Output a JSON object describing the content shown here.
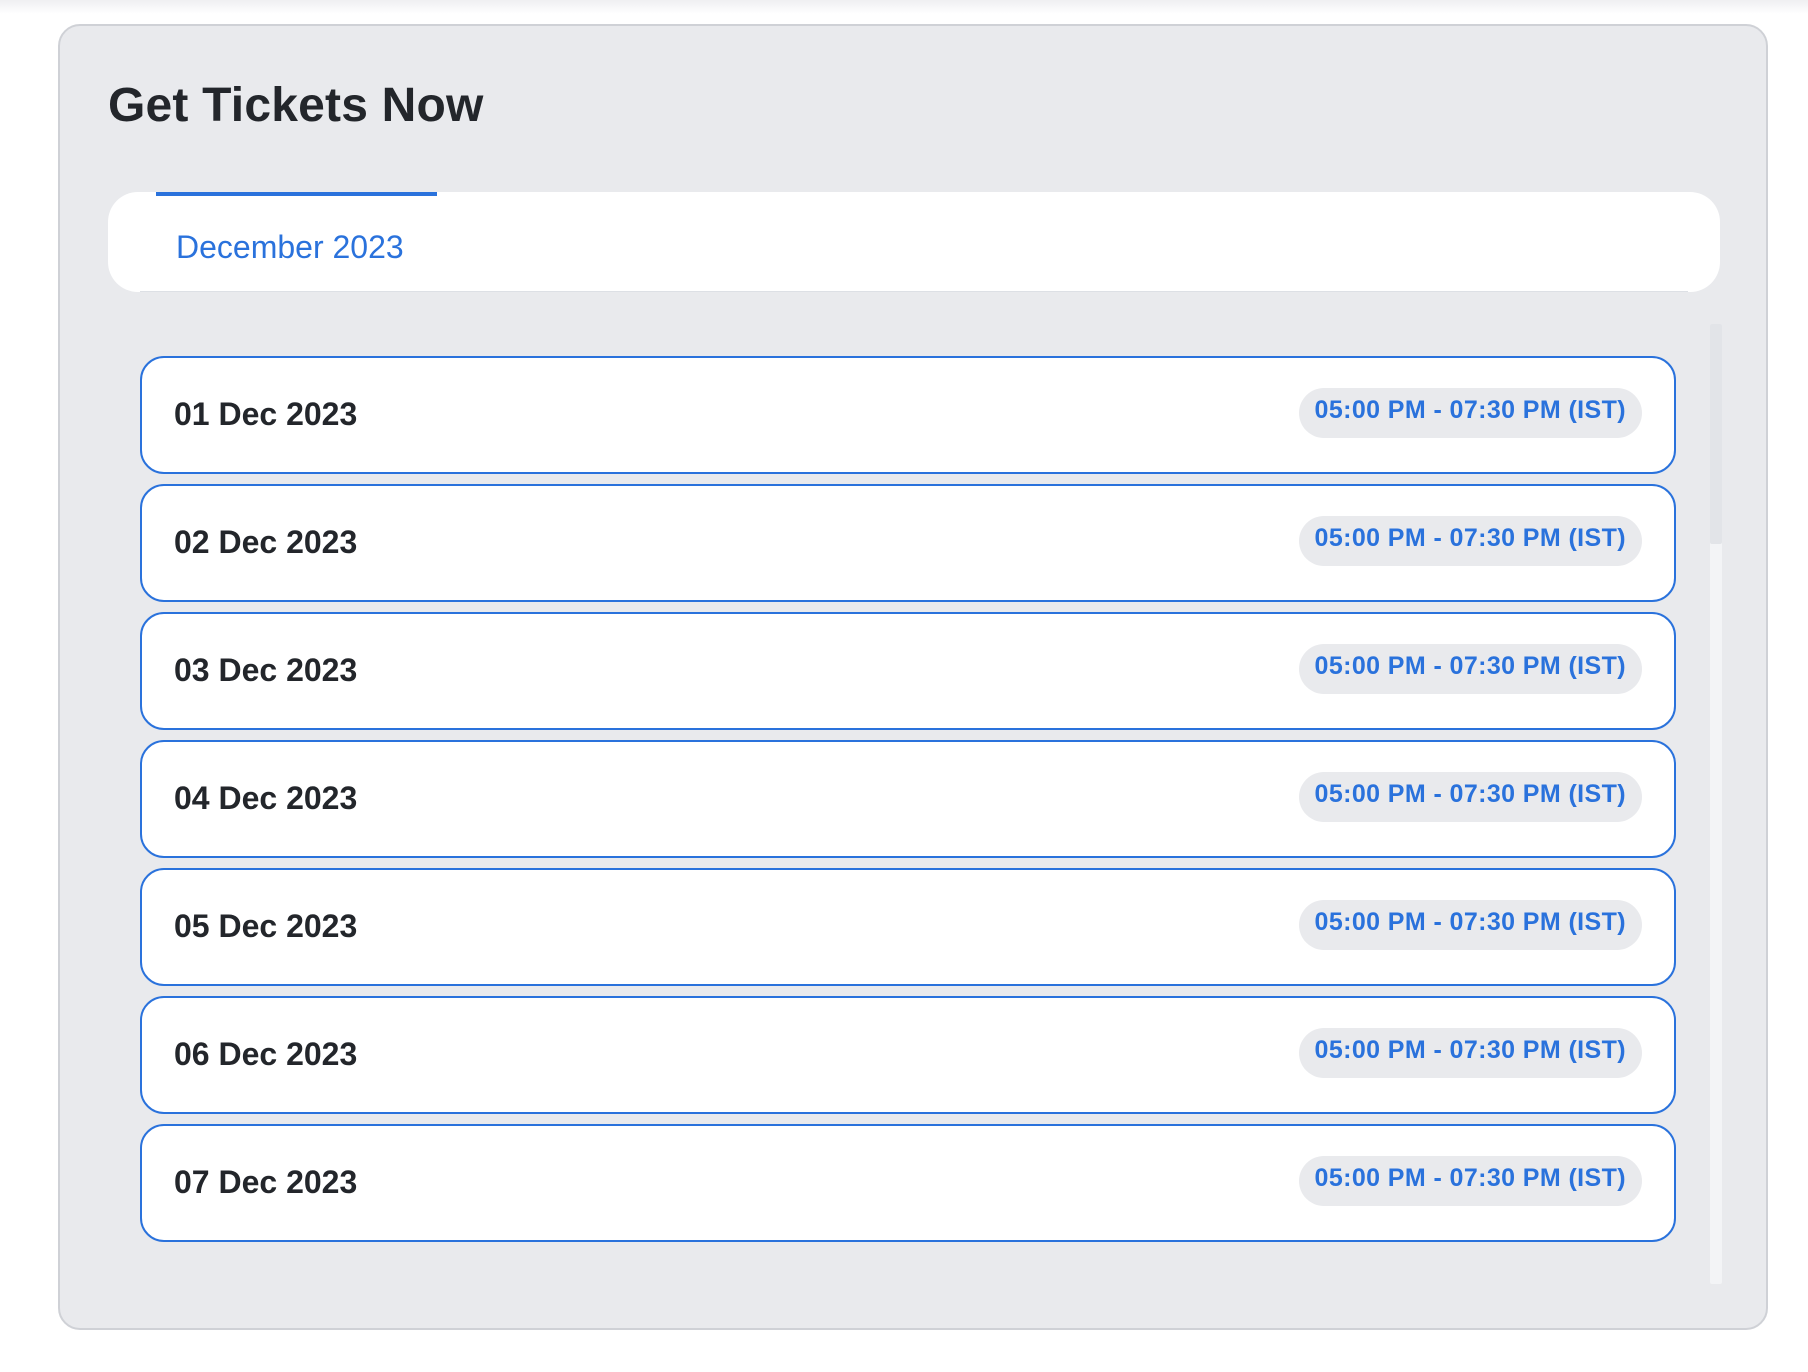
{
  "widget": {
    "title": "Get Tickets Now"
  },
  "tabs": [
    {
      "label": "December 2023",
      "active": true
    }
  ],
  "schedule": [
    {
      "date": "01 Dec 2023",
      "time": "05:00 PM - 07:30 PM (IST)"
    },
    {
      "date": "02 Dec 2023",
      "time": "05:00 PM - 07:30 PM (IST)"
    },
    {
      "date": "03 Dec 2023",
      "time": "05:00 PM - 07:30 PM (IST)"
    },
    {
      "date": "04 Dec 2023",
      "time": "05:00 PM - 07:30 PM (IST)"
    },
    {
      "date": "05 Dec 2023",
      "time": "05:00 PM - 07:30 PM (IST)"
    },
    {
      "date": "06 Dec 2023",
      "time": "05:00 PM - 07:30 PM (IST)"
    },
    {
      "date": "07 Dec 2023",
      "time": "05:00 PM - 07:30 PM (IST)"
    }
  ],
  "colors": {
    "accent": "#2a72dc",
    "card_background": "#e9eaed",
    "text_dark": "#23262b"
  }
}
